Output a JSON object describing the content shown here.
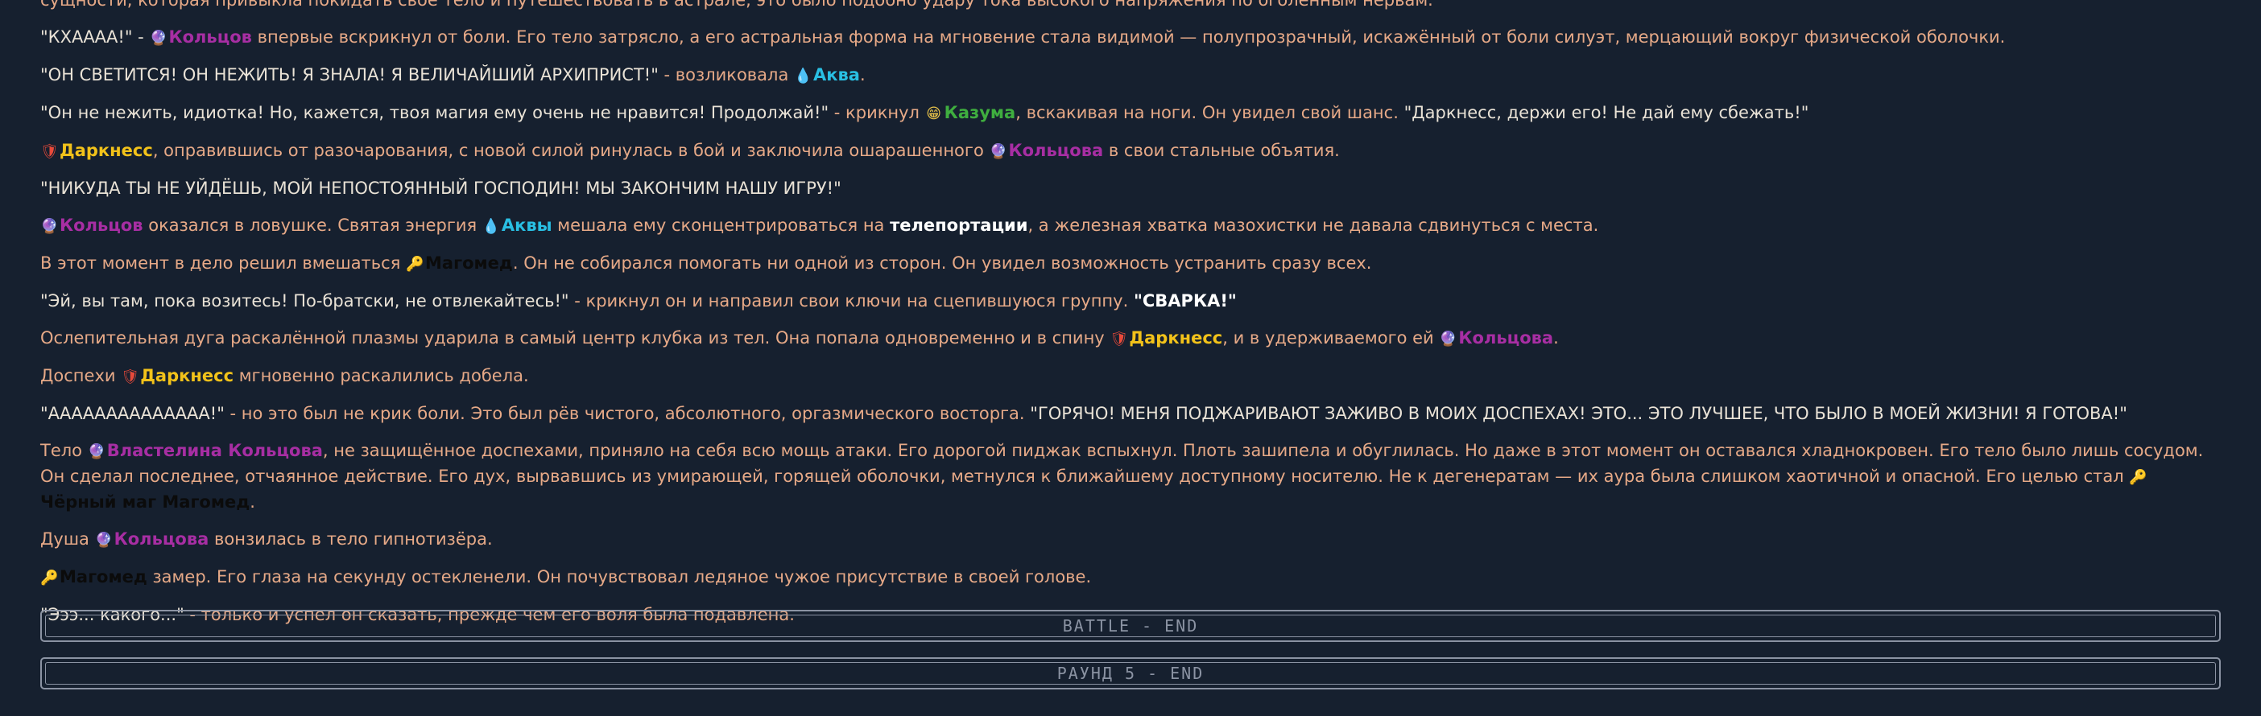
{
  "icons": {
    "koltsov": "crystal-ball-icon",
    "aqua": "water-drop-icon",
    "kazuma": "grinning-face-icon",
    "darkness": "shield-icon",
    "magomed": "key-icon"
  },
  "colors": {
    "background": "#16202f",
    "narration": "#e6a987",
    "quote": "#e9e2d6",
    "koltsov": "#a72ea3",
    "aqua": "#29bfe3",
    "kazuma": "#3fae3f",
    "darkness": "#f2c21a",
    "magomed": "#0b0b0b",
    "divider": "#8b93a3"
  },
  "log": {
    "p0": {
      "t1": "сущности, которая привыкла покидать свое тело и путешествовать в астрале, это было подобно удару тока высокого напряжения по оголенным нервам."
    },
    "p1": {
      "t1": "\"КХАААА!\" - ",
      "n1": "Кольцов",
      "t2": " впервые вскрикнул от боли. Его тело затряслo, а его астральная форма на мгновение стала видимой — полупрозрачный, искажённый от боли силуэт, мерцающий вокруг физической оболочки."
    },
    "p2": {
      "t1": "\"ОН СВЕТИТСЯ! ОН НЕЖИТЬ! Я ЗНАЛА! Я ВЕЛИЧАЙШИЙ АРХИПРИСТ!\"",
      "t2": " - возликовала ",
      "n1": "Аква",
      "t3": "."
    },
    "p3": {
      "t1": "\"Он не нежить, идиотка! Но, кажется, твоя магия ему очень не нравится! Продолжай!\"",
      "t2": " - крикнул ",
      "n1": "Казума",
      "t3": ", вскакивая на ноги. Он увидел свой шанс. ",
      "t4": "\"Даркнесс, держи его! Не дай ему сбежать!\""
    },
    "p4": {
      "n1": "Даркнесс",
      "t1": ", оправившись от разочарования, с новой силой ринулась в бой и заключила ошарашенного ",
      "n2": "Кольцова",
      "t2": " в свои стальные объятия."
    },
    "p5": {
      "t1": "\"НИКУДА ТЫ НЕ УЙДЁШЬ, МОЙ НЕПОСТОЯННЫЙ ГОСПОДИН! МЫ ЗАКОНЧИМ НАШУ ИГРУ!\""
    },
    "p6": {
      "n1": "Кольцов",
      "t1": " оказался в ловушке. Святая энергия ",
      "n2": "Аквы",
      "t2": " мешала ему сконцентрироваться на ",
      "b1": "телепортации",
      "t3": ", а железная хватка мазохистки не давала сдвинуться с места."
    },
    "p7": {
      "t1": "В этот момент в дело решил вмешаться ",
      "n1": "Магомед",
      "t2": ". Он не собирался помогать ни одной из сторон. Он увидел возможность устранить сразу всех."
    },
    "p8": {
      "t1": "\"Эй, вы там, пока возитесь! По-братски, не отвлекайтесь!\"",
      "t2": " - крикнул он и направил свои ключи на сцепившуюся группу. ",
      "b1": "\"СВАРКА!\""
    },
    "p9": {
      "t1": "Ослепительная дуга раскалённой плазмы ударила в самый центр клубка из тел. Она попала одновременно и в спину ",
      "n1": "Даркнесс",
      "t2": ", и в удерживаемого ей ",
      "n2": "Кольцова",
      "t3": "."
    },
    "p10": {
      "t1": "Доспехи ",
      "n1": "Даркнесс",
      "t2": " мгновенно раскалились добела."
    },
    "p11": {
      "t1": "\"АААААААААААААА!\"",
      "t2": " - но это был не крик боли. Это был рёв чистого, абсолютного, оргазмического восторга. ",
      "t3": "\"ГОРЯЧО! МЕНЯ ПОДЖАРИВАЮТ ЗАЖИВО В МОИХ ДОСПЕХАХ! ЭТО... ЭТО ЛУЧШЕЕ, ЧТО БЫЛО В МОЕЙ ЖИЗНИ! Я ГОТОВА!\""
    },
    "p12": {
      "t1": "Тело ",
      "n1": "Властелина Кольцова",
      "t2": ", не защищённое доспехами, приняло на себя всю мощь атаки. Его дорогой пиджак вспыхнул. Плоть зашипела и обуглилась. Но даже в этот момент он оставался хладнокровен. Его тело было лишь сосудом. Он сделал последнее, отчаянное действие. Его дух, вырвавшись из умирающей, горящей оболочки, метнулся к ближайшему доступному носителю. Не к дегенератам — их аура была слишком хаотичной и опасной. Его целью стал ",
      "n2": "Чёрный маг Магомед",
      "t3": "."
    },
    "p13": {
      "t1": "Душа ",
      "n1": "Кольцова",
      "t2": " вонзилась в тело гипнотизёра."
    },
    "p14": {
      "n1": "Магомед",
      "t1": " замер. Его глаза на секунду остекленели. Он почувствовал ледяное чужое присутствие в своей голове."
    },
    "p15": {
      "t1": "\"Эээ... какого...\"",
      "t2": " - только и успел он сказать, прежде чем его воля была подавлена."
    }
  },
  "dividers": {
    "battle_end": "BATTLE - END",
    "round_end": "РАУНД 5 - END"
  }
}
